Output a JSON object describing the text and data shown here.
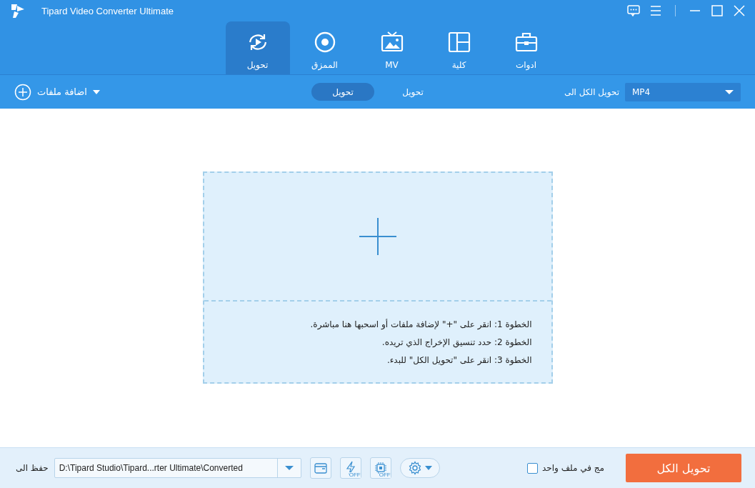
{
  "window": {
    "title": "Tipard Video Converter Ultimate"
  },
  "nav_tabs": [
    {
      "label": "ادوات",
      "kind": "toolbox",
      "selected": false
    },
    {
      "label": "كلية",
      "kind": "collage",
      "selected": false
    },
    {
      "label": "MV",
      "kind": "mv",
      "selected": false
    },
    {
      "label": "الممزق",
      "kind": "ripper",
      "selected": false
    },
    {
      "label": "تحويل",
      "kind": "convert",
      "selected": true
    }
  ],
  "toolbar": {
    "add_files": "اضافة ملفات",
    "segments": [
      {
        "label": "تحويل",
        "selected": false
      },
      {
        "label": "تحويل",
        "selected": true
      }
    ],
    "convert_all_label": "تحويل الكل الى",
    "format": "MP4"
  },
  "drop_zone": {
    "steps": [
      "الخطوة 1: انقر على \"+\" لإضافة ملفات أو اسحبها هنا مباشرة.",
      "الخطوة 2: حدد تنسيق الإخراج الذي تريده.",
      "الخطوة 3: انقر على \"تحويل الكل\" للبدء."
    ]
  },
  "bottom_bar": {
    "save_label": "حفظ الى",
    "path": "D:\\Tipard Studio\\Tipard...rter Ultimate\\Converted",
    "speed_badge": "OFF",
    "hw_badge": "OFF",
    "merge_label": "مج في ملف واحد",
    "merge_checked": false,
    "convert_all_button": "تحويل الكل"
  }
}
